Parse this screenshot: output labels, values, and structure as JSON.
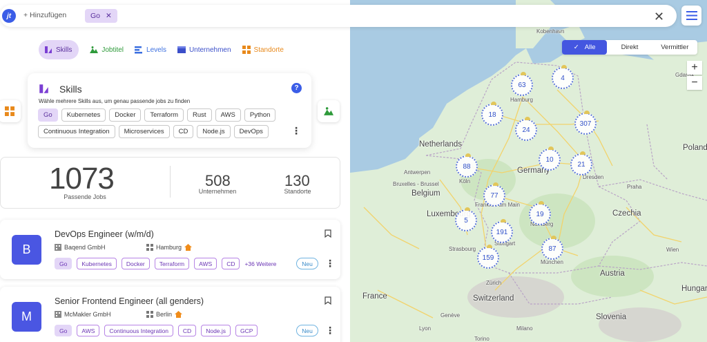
{
  "search": {
    "logo": "jt",
    "add_label": "+ Hinzufügen",
    "active_chip": "Go",
    "clear_icon": "close-icon",
    "menu_icon": "menu-icon"
  },
  "tabs": [
    {
      "label": "Skills",
      "color": "#7b3fd3",
      "icon": "skills-icon"
    },
    {
      "label": "Jobtitel",
      "color": "#2e9a3a",
      "icon": "mountain-icon"
    },
    {
      "label": "Levels",
      "color": "#3b6fe0",
      "icon": "levels-icon"
    },
    {
      "label": "Unternehmen",
      "color": "#3b4fc9",
      "icon": "company-icon"
    },
    {
      "label": "Standorte",
      "color": "#e8891b",
      "icon": "grid-icon"
    }
  ],
  "skills_card": {
    "title": "Skills",
    "subtitle": "Wähle mehrere Skills aus, um genau passende jobs zu finden",
    "row1": [
      "Go",
      "Kubernetes",
      "Docker",
      "Terraform",
      "Rust",
      "AWS",
      "Python"
    ],
    "row2": [
      "Continuous Integration",
      "Microservices",
      "CD",
      "Node.js",
      "DevOps"
    ]
  },
  "stats": {
    "jobs_value": "1073",
    "jobs_label": "Passende Jobs",
    "companies_value": "508",
    "companies_label": "Unternehmen",
    "locations_value": "130",
    "locations_label": "Standorte"
  },
  "jobs": [
    {
      "avatar": "B",
      "title": "DevOps Engineer (w/m/d)",
      "company": "Baqend GmbH",
      "location": "Hamburg",
      "tags": [
        "Go",
        "Kubernetes",
        "Docker",
        "Terraform",
        "AWS",
        "CD"
      ],
      "more": "+36 Weitere",
      "badge": "Neu"
    },
    {
      "avatar": "M",
      "title": "Senior Frontend Engineer (all genders)",
      "company": "McMakler GmbH",
      "location": "Berlin",
      "tags": [
        "Go",
        "AWS",
        "Continuous Integration",
        "CD",
        "Node.js",
        "GCP"
      ],
      "more": "",
      "badge": "Neu"
    }
  ],
  "map": {
    "filter": [
      "Alle",
      "Direkt",
      "Vermittler"
    ],
    "zoom_in": "+",
    "zoom_out": "−",
    "countries": [
      "Netherlands",
      "Germany",
      "Belgium",
      "Luxembourg",
      "Czechia",
      "Poland",
      "France",
      "Switzerland",
      "Austria",
      "Slovenia",
      "Hungary"
    ],
    "cities": [
      "Kobenhavn",
      "Gdansk",
      "Hamburg",
      "Antwerpen",
      "Bruxelles - Brussel",
      "Köln",
      "Dresden",
      "Frankfurt am Main",
      "Nürnberg",
      "Stuttgart",
      "Strasbourg",
      "München",
      "Zürich",
      "Genève",
      "Lyon",
      "Milano",
      "Torino",
      "Wien",
      "Praha"
    ],
    "clusters": [
      {
        "label": "63"
      },
      {
        "label": "4"
      },
      {
        "label": "18"
      },
      {
        "label": "24"
      },
      {
        "label": "307"
      },
      {
        "label": "88"
      },
      {
        "label": "10"
      },
      {
        "label": "21"
      },
      {
        "label": "77"
      },
      {
        "label": "19"
      },
      {
        "label": "5"
      },
      {
        "label": "191"
      },
      {
        "label": "87"
      },
      {
        "label": "159"
      }
    ],
    "colors": {
      "water": "#a9cbe3",
      "land": "#dfeed8",
      "accent": "#4456e0"
    }
  }
}
